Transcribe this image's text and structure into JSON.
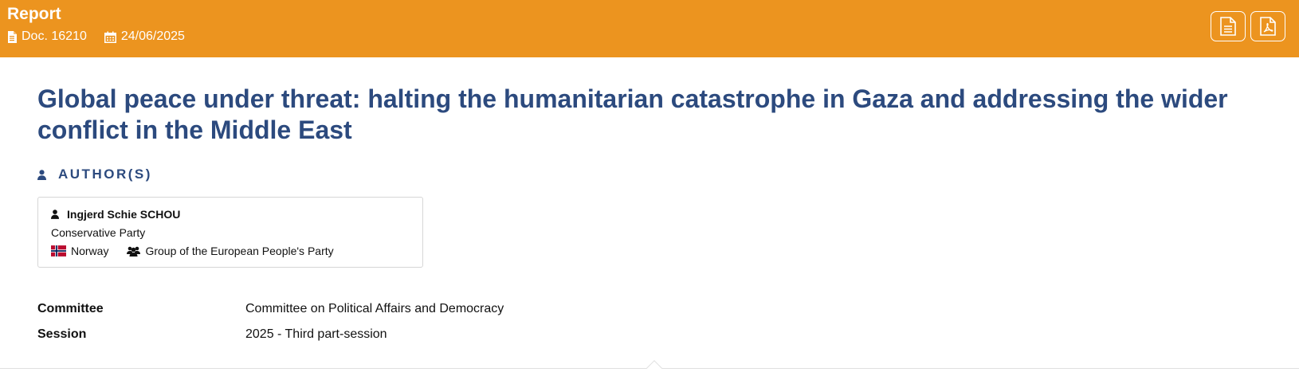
{
  "header": {
    "doc_type": "Report",
    "doc_number": "Doc. 16210",
    "date": "24/06/2025",
    "actions": [
      {
        "icon": "document-icon"
      },
      {
        "icon": "pdf-icon"
      }
    ],
    "background_color": "#ec941f"
  },
  "title": "Global peace under threat: halting the humanitarian catastrophe in Gaza and addressing the wider conflict in the Middle East",
  "authors_heading": "AUTHOR(S)",
  "authors": [
    {
      "name": "Ingjerd Schie SCHOU",
      "party": "Conservative Party",
      "country": "Norway",
      "group": "Group of the European People's Party"
    }
  ],
  "info": {
    "committee_label": "Committee",
    "committee_value": "Committee on Political Affairs and Democracy",
    "session_label": "Session",
    "session_value": "2025 - Third part-session"
  },
  "colors": {
    "accent": "#ec941f",
    "title": "#2c4a7e"
  }
}
